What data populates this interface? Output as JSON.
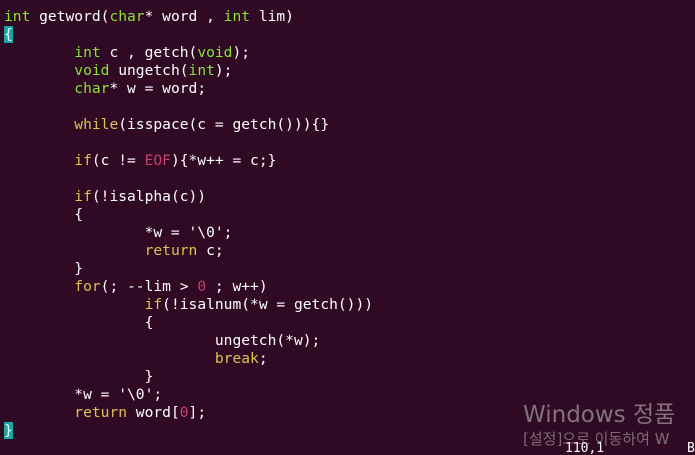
{
  "editor": {
    "lines": [
      {
        "segments": [
          {
            "t": "int",
            "c": "type"
          },
          {
            "t": " getword(",
            "c": ""
          },
          {
            "t": "char",
            "c": "type"
          },
          {
            "t": "* word , ",
            "c": ""
          },
          {
            "t": "int",
            "c": "type"
          },
          {
            "t": " lim)",
            "c": ""
          }
        ]
      },
      {
        "segments": [
          {
            "t": "{",
            "c": "cursor"
          }
        ]
      },
      {
        "segments": [
          {
            "t": "        ",
            "c": ""
          },
          {
            "t": "int",
            "c": "type"
          },
          {
            "t": " c , getch(",
            "c": ""
          },
          {
            "t": "void",
            "c": "type"
          },
          {
            "t": ");",
            "c": ""
          }
        ]
      },
      {
        "segments": [
          {
            "t": "        ",
            "c": ""
          },
          {
            "t": "void",
            "c": "type"
          },
          {
            "t": " ungetch(",
            "c": ""
          },
          {
            "t": "int",
            "c": "type"
          },
          {
            "t": ");",
            "c": ""
          }
        ]
      },
      {
        "segments": [
          {
            "t": "        ",
            "c": ""
          },
          {
            "t": "char",
            "c": "type"
          },
          {
            "t": "* w = word;",
            "c": ""
          }
        ]
      },
      {
        "segments": []
      },
      {
        "segments": [
          {
            "t": "        ",
            "c": ""
          },
          {
            "t": "while",
            "c": "kw"
          },
          {
            "t": "(isspace(c = getch())){}",
            "c": ""
          }
        ]
      },
      {
        "segments": []
      },
      {
        "segments": [
          {
            "t": "        ",
            "c": ""
          },
          {
            "t": "if",
            "c": "kw"
          },
          {
            "t": "(c != ",
            "c": ""
          },
          {
            "t": "EOF",
            "c": "num"
          },
          {
            "t": "){*w++ = c;}",
            "c": ""
          }
        ]
      },
      {
        "segments": []
      },
      {
        "segments": [
          {
            "t": "        ",
            "c": ""
          },
          {
            "t": "if",
            "c": "kw"
          },
          {
            "t": "(!isalpha(c))",
            "c": ""
          }
        ]
      },
      {
        "segments": [
          {
            "t": "        {",
            "c": ""
          }
        ]
      },
      {
        "segments": [
          {
            "t": "                *w = ",
            "c": ""
          },
          {
            "t": "'\\0'",
            "c": "str"
          },
          {
            "t": ";",
            "c": ""
          }
        ]
      },
      {
        "segments": [
          {
            "t": "                ",
            "c": ""
          },
          {
            "t": "return",
            "c": "kw"
          },
          {
            "t": " c;",
            "c": ""
          }
        ]
      },
      {
        "segments": [
          {
            "t": "        }",
            "c": ""
          }
        ]
      },
      {
        "segments": [
          {
            "t": "        ",
            "c": ""
          },
          {
            "t": "for",
            "c": "kw"
          },
          {
            "t": "(; --lim > ",
            "c": ""
          },
          {
            "t": "0",
            "c": "num"
          },
          {
            "t": " ; w++)",
            "c": ""
          }
        ]
      },
      {
        "segments": [
          {
            "t": "                ",
            "c": ""
          },
          {
            "t": "if",
            "c": "kw"
          },
          {
            "t": "(!isalnum(*w = getch()))",
            "c": ""
          }
        ]
      },
      {
        "segments": [
          {
            "t": "                {",
            "c": ""
          }
        ]
      },
      {
        "segments": [
          {
            "t": "                        ungetch(*w);",
            "c": ""
          }
        ]
      },
      {
        "segments": [
          {
            "t": "                        ",
            "c": ""
          },
          {
            "t": "break",
            "c": "kw"
          },
          {
            "t": ";",
            "c": ""
          }
        ]
      },
      {
        "segments": [
          {
            "t": "                }",
            "c": ""
          }
        ]
      },
      {
        "segments": [
          {
            "t": "        *w = ",
            "c": ""
          },
          {
            "t": "'\\0'",
            "c": "str"
          },
          {
            "t": ";",
            "c": ""
          }
        ]
      },
      {
        "segments": [
          {
            "t": "        ",
            "c": ""
          },
          {
            "t": "return",
            "c": "kw"
          },
          {
            "t": " word[",
            "c": ""
          },
          {
            "t": "0",
            "c": "num"
          },
          {
            "t": "];",
            "c": ""
          }
        ]
      },
      {
        "segments": [
          {
            "t": "}",
            "c": "cursor"
          }
        ]
      }
    ],
    "status_position": "110,1",
    "status_scroll": "B"
  },
  "watermark": {
    "title": "Windows 정품",
    "subtitle": "[설정]으로 이동하여 W"
  },
  "colors": {
    "background": "#300a24",
    "keyword": "#e0c050",
    "type": "#8ae234",
    "number": "#cc3f72",
    "cursor": "#1aa6a6"
  }
}
